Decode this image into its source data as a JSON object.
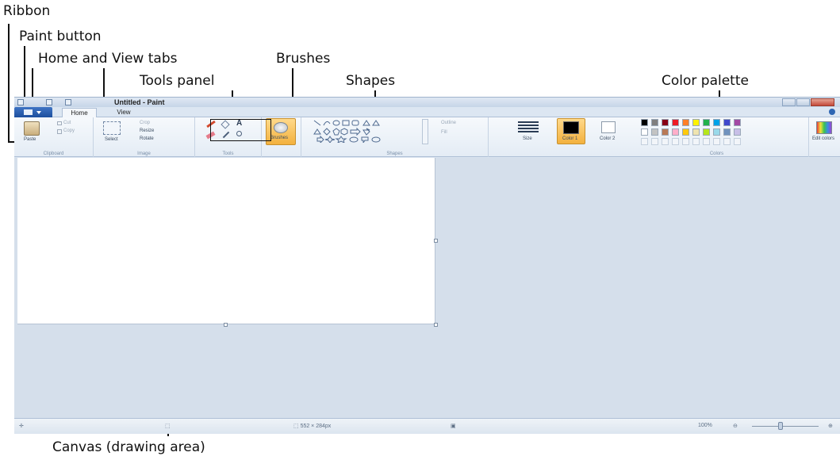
{
  "annotations": {
    "ribbon": "Ribbon",
    "paint_button": "Paint button",
    "home_view_tabs": "Home and View tabs",
    "brushes": "Brushes",
    "tools_panel": "Tools panel",
    "shapes": "Shapes",
    "color_palette": "Color palette",
    "canvas": "Canvas (drawing area)"
  },
  "window": {
    "title": "Untitled - Paint",
    "tabs": [
      "Home",
      "View"
    ]
  },
  "ribbon": {
    "clipboard": {
      "paste": "Paste",
      "cut": "Cut",
      "copy": "Copy",
      "label": "Clipboard"
    },
    "image": {
      "select": "Select",
      "crop": "Crop",
      "resize": "Resize",
      "rotate": "Rotate",
      "label": "Image"
    },
    "tools": {
      "label": "Tools"
    },
    "brushes": {
      "label": "Brushes"
    },
    "shapes": {
      "outline": "Outline",
      "fill": "Fill",
      "label": "Shapes"
    },
    "size": {
      "label": "Size"
    },
    "color1": {
      "label": "Color 1"
    },
    "color2": {
      "label": "Color 2"
    },
    "colors": {
      "label": "Colors"
    },
    "edit_colors": {
      "label": "Edit colors"
    }
  },
  "palette": {
    "row1": [
      "#000000",
      "#7f7f7f",
      "#880015",
      "#ed1c24",
      "#ff7f27",
      "#fff200",
      "#22b14c",
      "#00a2e8",
      "#3f48cc",
      "#a349a4"
    ],
    "row2": [
      "#ffffff",
      "#c3c3c3",
      "#b97a57",
      "#ffaec9",
      "#ffc90e",
      "#efe4b0",
      "#b5e61d",
      "#99d9ea",
      "#7092be",
      "#c8bfe7"
    ],
    "color1": "#000000",
    "color2": "#ffffff"
  },
  "status": {
    "image_size": "552 × 284px",
    "zoom": "100%"
  }
}
